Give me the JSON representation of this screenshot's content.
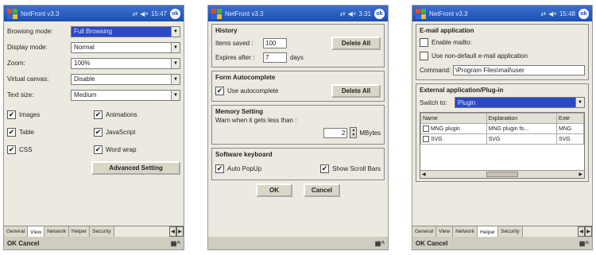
{
  "app_title": "NetFront v3.3",
  "screens": [
    {
      "status_time": "15:47",
      "view_settings": [
        {
          "label": "Browsing mode:",
          "value": "Full Browsing",
          "highlighted": true
        },
        {
          "label": "Display mode:",
          "value": "Normal"
        },
        {
          "label": "Zoom:",
          "value": "100%"
        },
        {
          "label": "Virtual canvas:",
          "value": "Disable"
        },
        {
          "label": "Text size:",
          "value": "Medium"
        }
      ],
      "checkboxes": [
        {
          "label": "Images",
          "checked": true
        },
        {
          "label": "Animations",
          "checked": true
        },
        {
          "label": "Table",
          "checked": true
        },
        {
          "label": "JavaScript",
          "checked": true
        },
        {
          "label": "CSS",
          "checked": true
        },
        {
          "label": "Word wrap",
          "checked": true
        }
      ],
      "advanced_button": "Advanced Setting",
      "tabs": [
        "General",
        "View",
        "Network",
        "Helper",
        "Security"
      ],
      "active_tab": "View",
      "bottom_left": "OK Cancel"
    },
    {
      "status_time": "3:31",
      "history": {
        "title": "History",
        "items_saved_label": "Items saved :",
        "items_saved_value": "100",
        "expires_label": "Expires after :",
        "expires_value": "7",
        "expires_unit": "days",
        "delete_label": "Delete All"
      },
      "form": {
        "title": "Form Autocomplete",
        "use_label": "Use autocomplete",
        "delete_label": "Delete All"
      },
      "memory": {
        "title": "Memory Setting",
        "warn_label": "Warn when it gets less than :",
        "value": "2",
        "unit": "MBytes"
      },
      "keyboard": {
        "title": "Software keyboard",
        "auto_popup": "Auto PopUp",
        "show_scroll": "Show Scroll Bars"
      },
      "ok": "OK",
      "cancel": "Cancel"
    },
    {
      "status_time": "15:48",
      "email": {
        "title": "E-mail application",
        "enable": "Enable mailto:",
        "use_non_default": "Use non-default e-mail application",
        "command_label": "Command:",
        "command_value": "\\Program Files\\mail\\user"
      },
      "external": {
        "title": "External application/Plug-in",
        "switch_label": "Switch to:",
        "switch_value": "Plugin",
        "columns": [
          "Name",
          "Explanation",
          "Exte"
        ],
        "rows": [
          [
            "MNG plugin",
            "MNG plugin fo...",
            "MNG"
          ],
          [
            "SVG",
            "SVG",
            "SVG"
          ]
        ]
      },
      "tabs": [
        "General",
        "View",
        "Network",
        "Helper",
        "Security"
      ],
      "active_tab": "Helper",
      "bottom_left": "OK Cancel"
    }
  ]
}
